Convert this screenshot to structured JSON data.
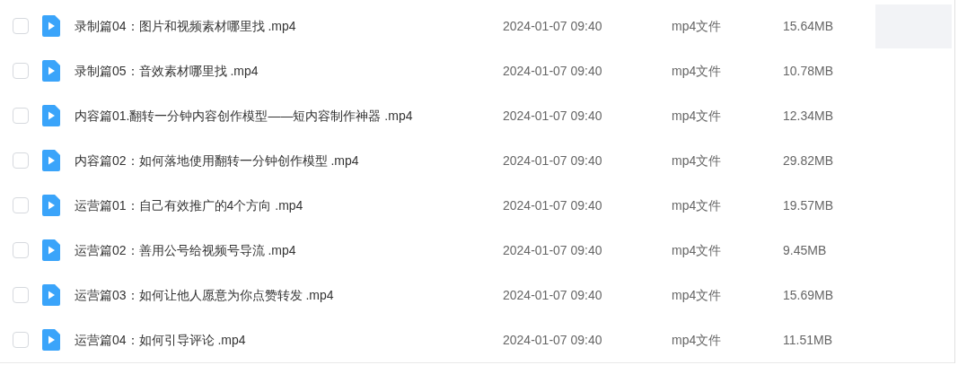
{
  "files": [
    {
      "name": "录制篇04：图片和视频素材哪里找 .mp4",
      "date": "2024-01-07 09:40",
      "type": "mp4文件",
      "size": "15.64MB",
      "checked": false,
      "hovered": true
    },
    {
      "name": "录制篇05：音效素材哪里找 .mp4",
      "date": "2024-01-07 09:40",
      "type": "mp4文件",
      "size": "10.78MB",
      "checked": false,
      "hovered": false
    },
    {
      "name": "内容篇01.翻转一分钟内容创作模型——短内容制作神器 .mp4",
      "date": "2024-01-07 09:40",
      "type": "mp4文件",
      "size": "12.34MB",
      "checked": false,
      "hovered": false
    },
    {
      "name": "内容篇02：如何落地使用翻转一分钟创作模型 .mp4",
      "date": "2024-01-07 09:40",
      "type": "mp4文件",
      "size": "29.82MB",
      "checked": false,
      "hovered": false
    },
    {
      "name": "运营篇01：自己有效推广的4个方向 .mp4",
      "date": "2024-01-07 09:40",
      "type": "mp4文件",
      "size": "19.57MB",
      "checked": false,
      "hovered": false
    },
    {
      "name": "运营篇02：善用公号给视频号导流 .mp4",
      "date": "2024-01-07 09:40",
      "type": "mp4文件",
      "size": "9.45MB",
      "checked": false,
      "hovered": false
    },
    {
      "name": "运营篇03：如何让他人愿意为你点赞转发 .mp4",
      "date": "2024-01-07 09:40",
      "type": "mp4文件",
      "size": "15.69MB",
      "checked": false,
      "hovered": false
    },
    {
      "name": "运营篇04：如何引导评论 .mp4",
      "date": "2024-01-07 09:40",
      "type": "mp4文件",
      "size": "11.51MB",
      "checked": false,
      "hovered": false
    }
  ]
}
